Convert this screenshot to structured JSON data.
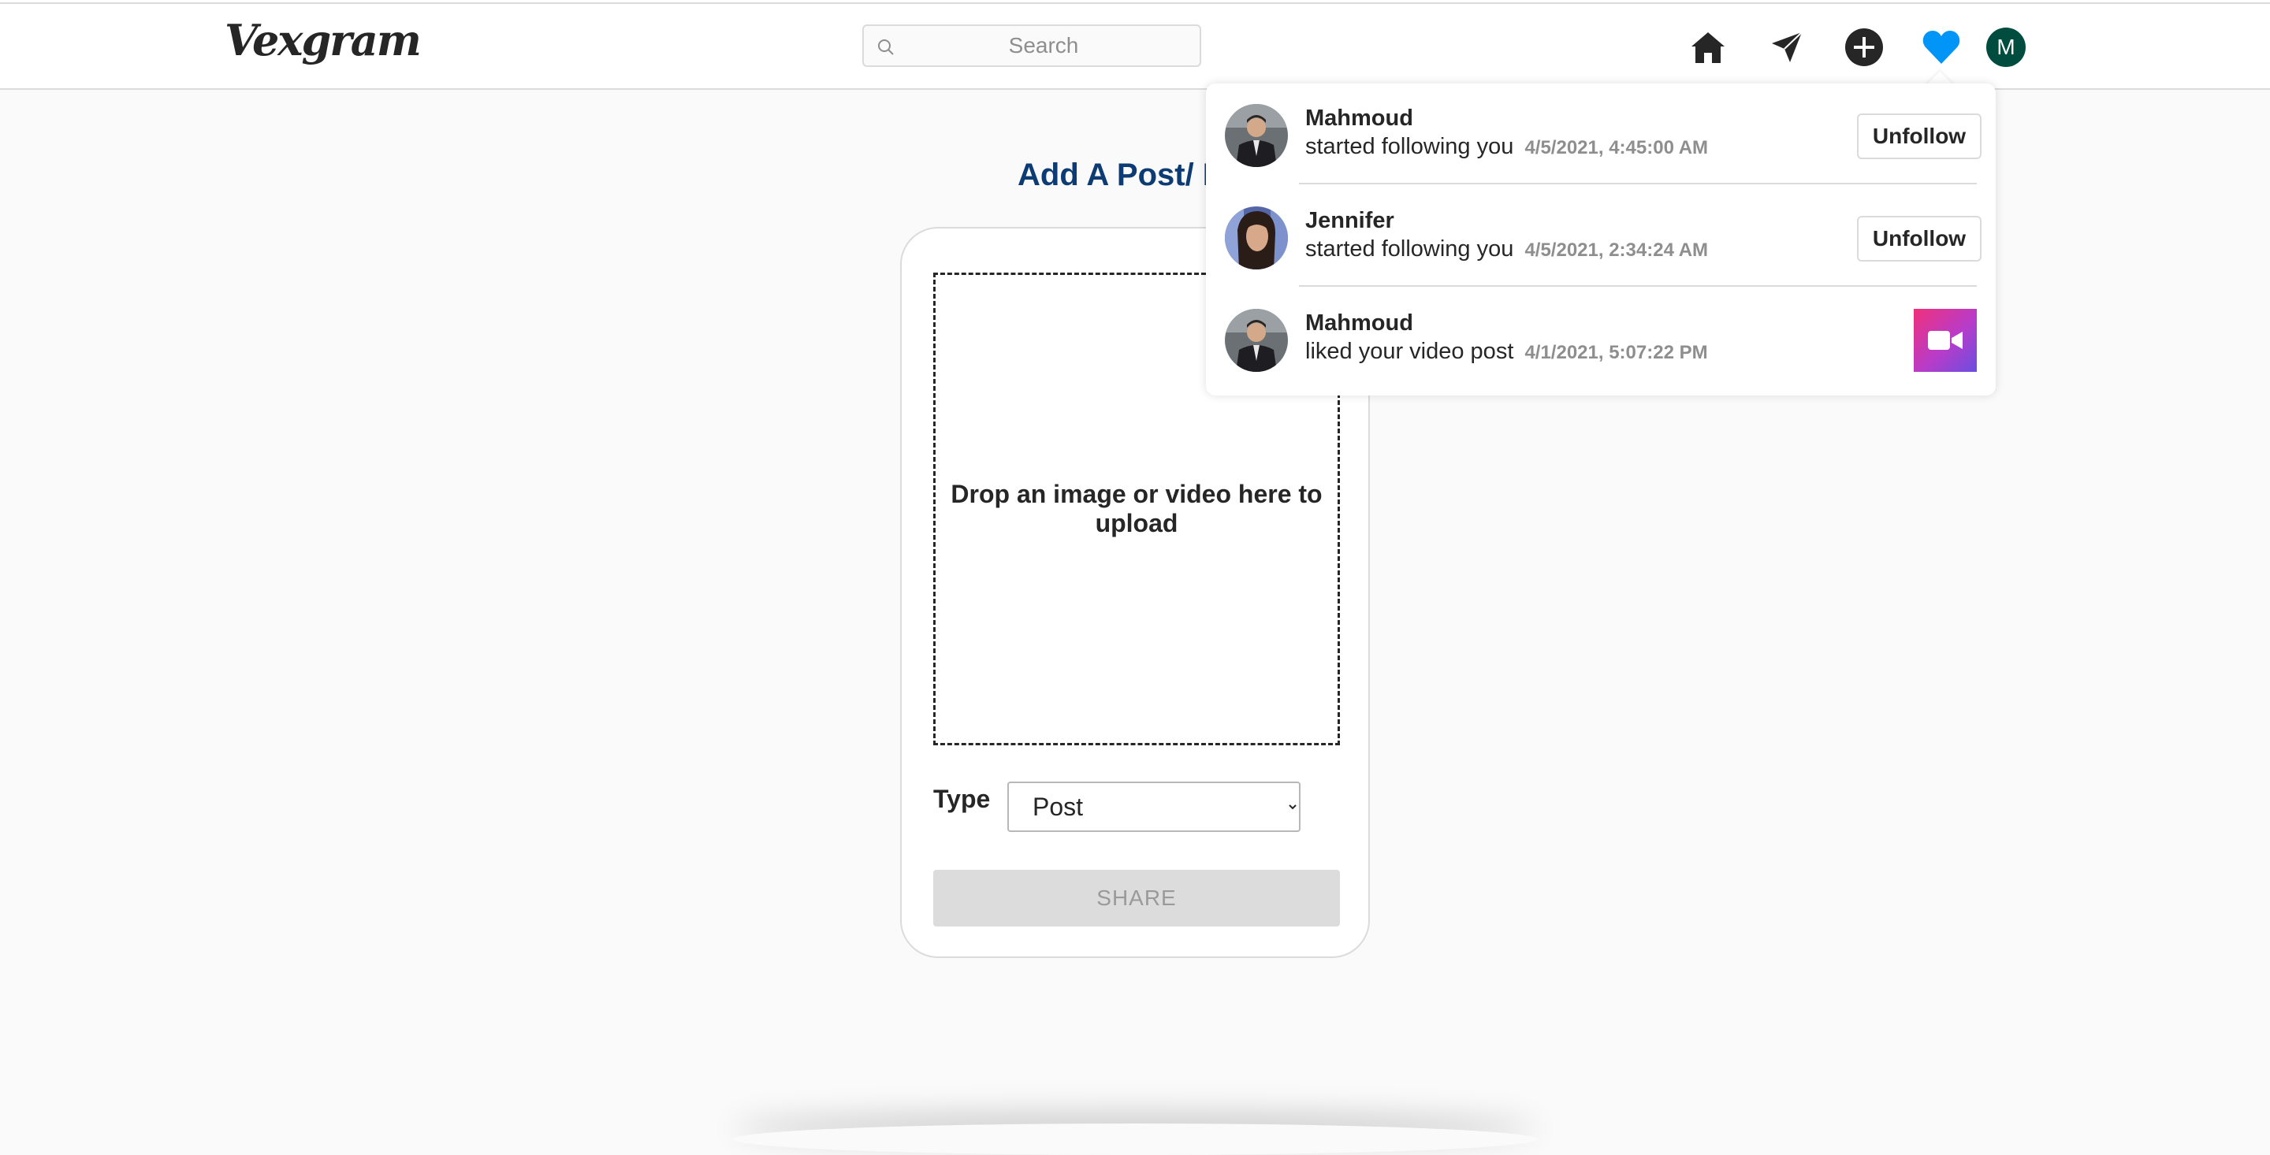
{
  "app": {
    "logo_text": "Vexgram"
  },
  "header": {
    "search_placeholder": "Search",
    "avatar_initial": "M",
    "colors": {
      "heart_active": "#0095f6",
      "avatar_bg": "#004d40"
    }
  },
  "main": {
    "title": "Add A Post/ R",
    "dropzone_text": "Drop an image or video here to upload",
    "type_label": "Type",
    "type_selected": "Post",
    "share_label": "SHARE"
  },
  "notifications": [
    {
      "name": "Mahmoud",
      "action": "started following you",
      "time": "4/5/2021, 4:45:00 AM",
      "button": "Unfollow",
      "avatar": "man-avatar"
    },
    {
      "name": "Jennifer",
      "action": "started following you",
      "time": "4/5/2021, 2:34:24 AM",
      "button": "Unfollow",
      "avatar": "woman-avatar"
    },
    {
      "name": "Mahmoud",
      "action": "liked your video post",
      "time": "4/1/2021, 5:07:22 PM",
      "thumbnail": "video-camera-icon",
      "avatar": "man-avatar"
    }
  ]
}
